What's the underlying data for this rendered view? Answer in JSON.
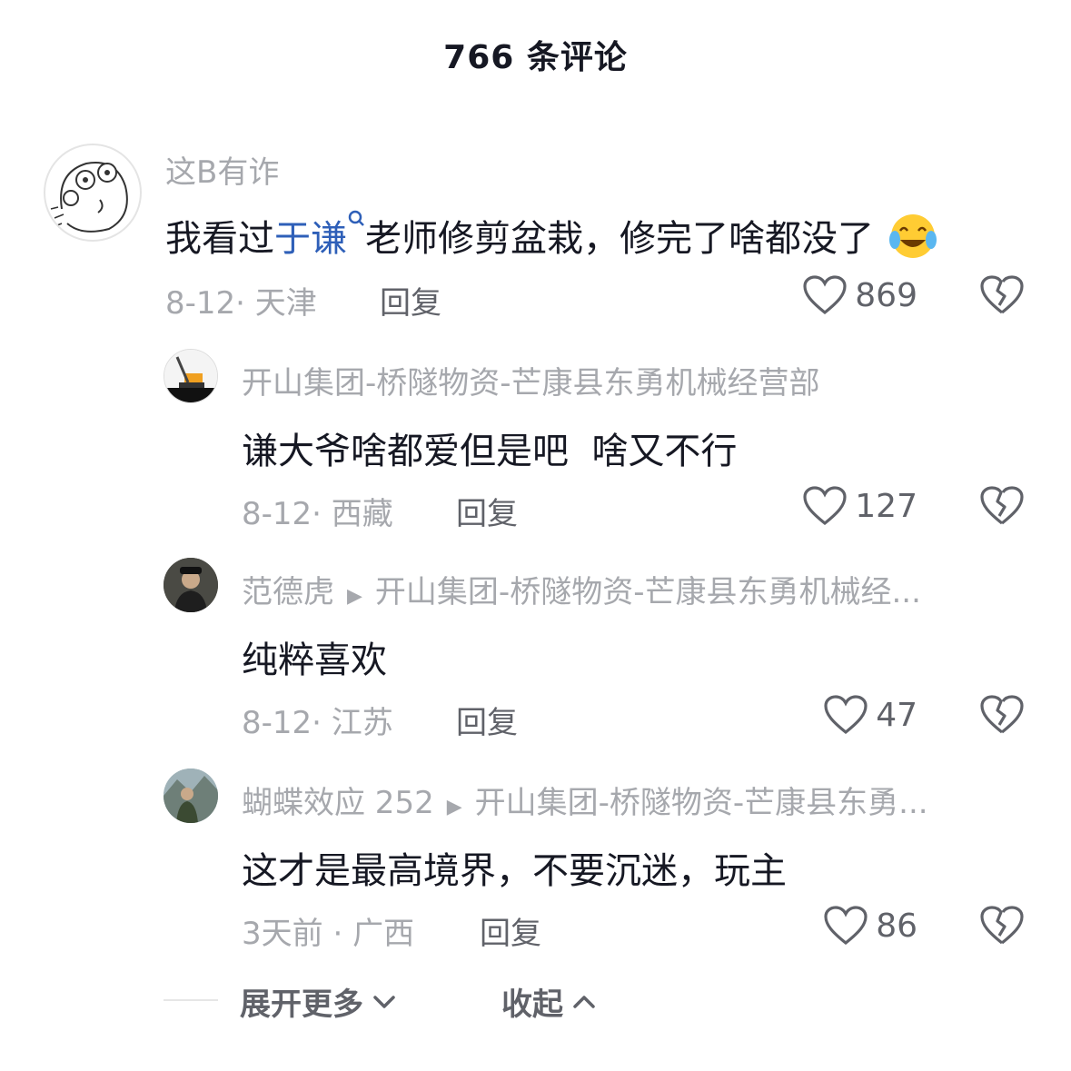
{
  "header": {
    "title": "766 条评论"
  },
  "comments": [
    {
      "username": "这B有诈",
      "text_before": "我看过",
      "hashtag": "于谦",
      "text_after": "老师修剪盆栽，修完了啥都没了",
      "emoji": "crying-laughing",
      "date": "8-12",
      "location": "天津",
      "reply_label": "回复",
      "likes": "869"
    }
  ],
  "replies": [
    {
      "username": "开山集团-桥隧物资-芒康县东勇机械经营部",
      "reply_to": "",
      "text": "谦大爷啥都爱但是吧  啥又不行",
      "date": "8-12",
      "location": "西藏",
      "reply_label": "回复",
      "likes": "127"
    },
    {
      "username": "范德虎",
      "reply_to": "开山集团-桥隧物资-芒康县东勇机械经...",
      "text": "纯粹喜欢",
      "date": "8-12",
      "location": "江苏",
      "reply_label": "回复",
      "likes": "47"
    },
    {
      "username": "蝴蝶效应 252",
      "reply_to": "开山集团-桥隧物资-芒康县东勇...",
      "text": "这才是最高境界，不要沉迷，玩主",
      "date": "3天前",
      "location": "广西",
      "reply_label": "回复",
      "likes": "86"
    }
  ],
  "footer": {
    "expand_label": "展开更多",
    "collapse_label": "收起"
  },
  "colors": {
    "text": "#161823",
    "muted": "#a6a8ad",
    "secondary": "#606269",
    "hashtag": "#2e5fb8"
  }
}
